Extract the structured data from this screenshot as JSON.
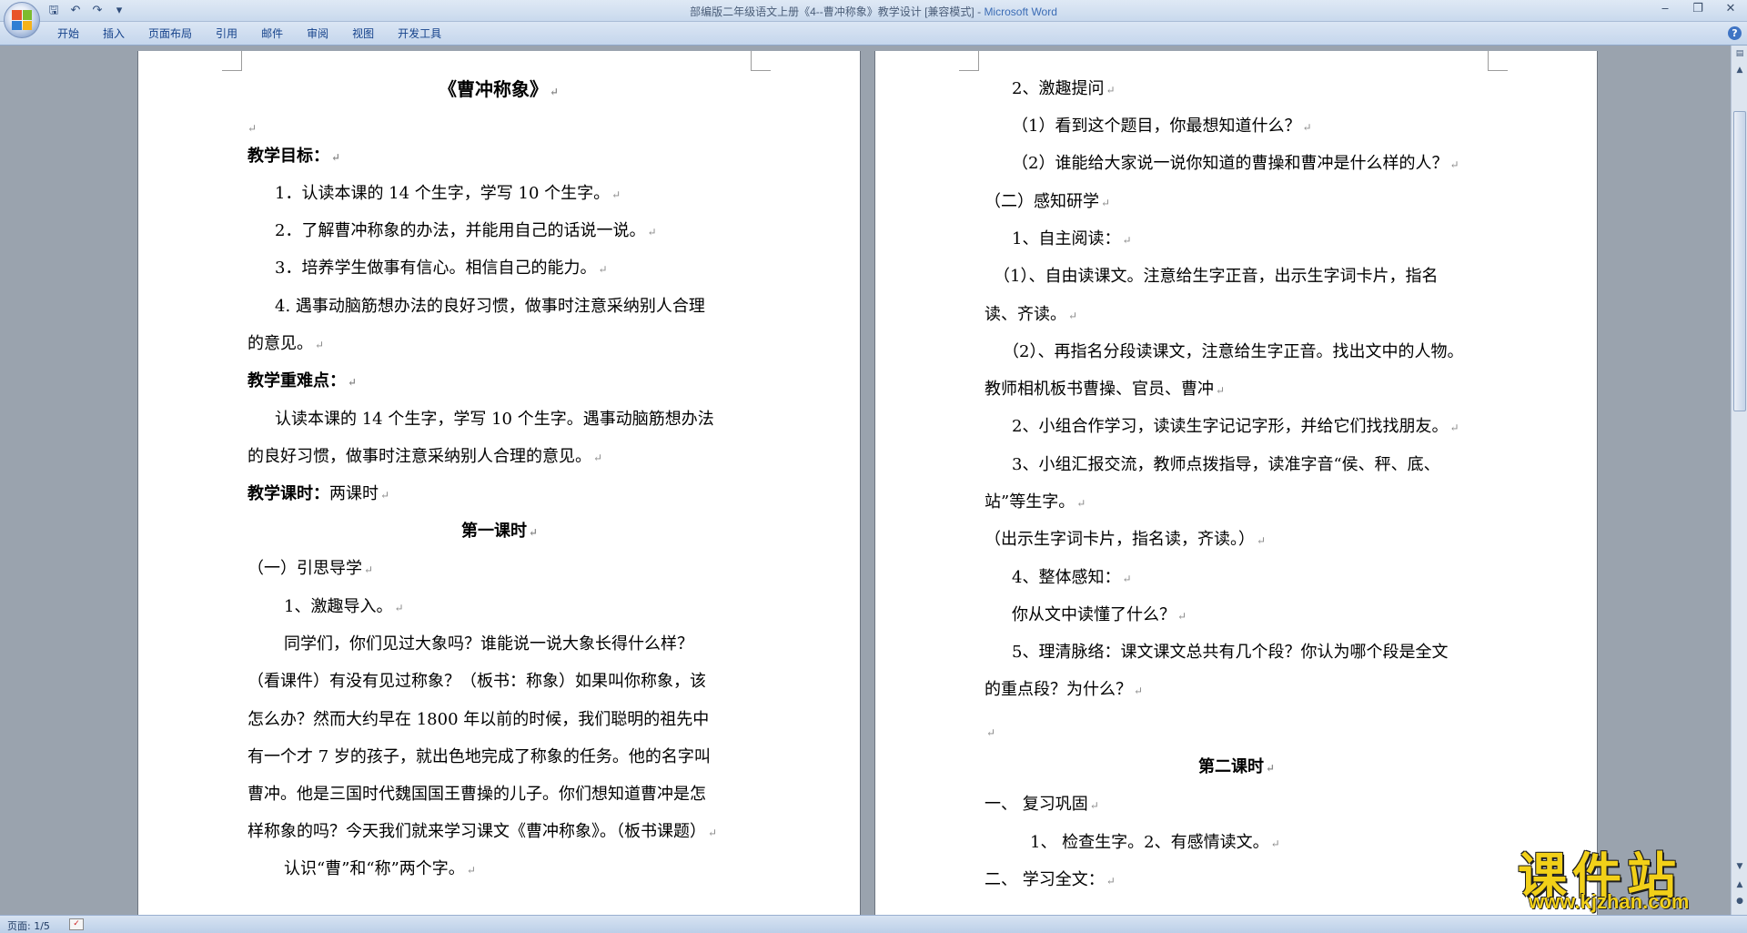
{
  "window": {
    "title_doc": "部编版二年级语文上册《4--曹冲称象》教学设计 [兼容模式] - ",
    "title_app": "Microsoft Word"
  },
  "qat": {
    "save_icon": "save-icon",
    "undo_icon": "undo-icon",
    "redo_icon": "redo-icon",
    "customize_icon": "dropdown-icon"
  },
  "ribbon": {
    "tabs": [
      "开始",
      "插入",
      "页面布局",
      "引用",
      "邮件",
      "审阅",
      "视图",
      "开发工具"
    ],
    "help": "?"
  },
  "left_page": {
    "title": "《曹冲称象》",
    "lines": [
      "",
      "教学目标：",
      "1．认读本课的 14 个生字，学写 10 个生字。",
      "2．了解曹冲称象的办法，并能用自己的话说一说。",
      "3．培养学生做事有信心。相信自己的能力。",
      "4. 遇事动脑筋想办法的良好习惯，做事时注意采纳别人合理",
      "的意见。",
      "教学重难点：",
      "认读本课的 14 个生字，学写 10 个生字。遇事动脑筋想办法",
      "的良好习惯，做事时注意采纳别人合理的意见。",
      "两课时",
      "第一课时",
      "（一）引思导学",
      "1、激趣导入。",
      "同学们，你们见过大象吗？谁能说一说大象长得什么样？",
      "（看课件）有没有见过称象？（板书：称象）如果叫你称象，该",
      "怎么办？然而大约早在 1800 年以前的时候，我们聪明的祖先中",
      "有一个才 7 岁的孩子，就出色地完成了称象的任务。他的名字叫",
      "曹冲。他是三国时代魏国国王曹操的儿子。你们想知道曹冲是怎",
      "样称象的吗？今天我们就来学习课文《曹冲称象》。（板书课题）",
      "认识“曹”和“称”两个字。"
    ],
    "lesson_hours_label": "教学课时："
  },
  "right_page": {
    "lines": [
      "2、激趣提问",
      "（1）看到这个题目，你最想知道什么？",
      "（2）谁能给大家说一说你知道的曹操和曹冲是什么样的人？",
      "（二）感知研学",
      "1、自主阅读：",
      "（1）、自由读课文。注意给生字正音，出示生字词卡片，指名",
      "读、齐读。",
      "（2）、再指名分段读课文，注意给生字正音。找出文中的人物。",
      "教师相机板书曹操、官员、曹冲",
      "2、小组合作学习，读读生字记记字形，并给它们找找朋友。",
      "3、小组汇报交流，教师点拨指导，读准字音“侯、秤、底、",
      "站”等生字。",
      "（出示生字词卡片，指名读，齐读。）",
      "4、整体感知：",
      "你从文中读懂了什么？",
      "5、理清脉络：课文课文总共有几个段？你认为哪个段是全文",
      "的重点段？为什么？",
      "",
      "第二课时",
      "一、   复习巩固",
      "1、  检查生字。2、有感情读文。",
      "二、   学习全文："
    ]
  },
  "status": {
    "page": "页面: 1/5"
  },
  "watermark": {
    "main": "课件站",
    "url": "www.kjzhan.com"
  }
}
